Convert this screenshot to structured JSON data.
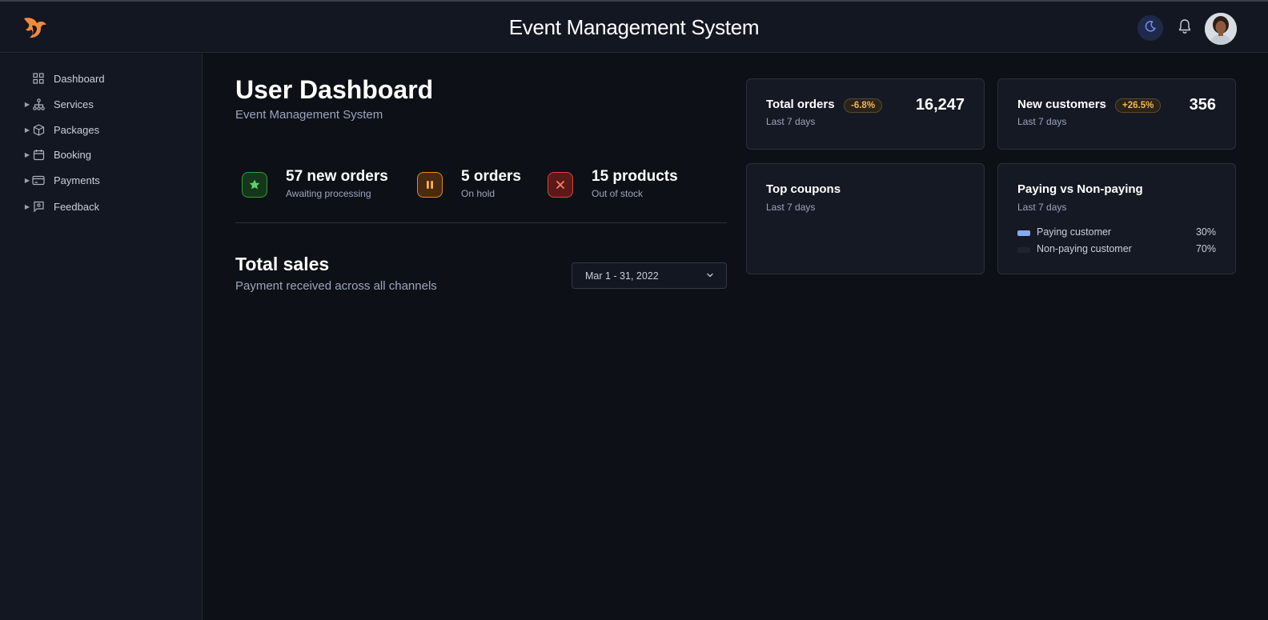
{
  "header": {
    "title": "Event Management System",
    "logo_icon": "flame-logo",
    "theme_icon": "moon-icon",
    "notification_icon": "bell-icon",
    "avatar_icon": "user-avatar"
  },
  "sidebar": {
    "items": [
      {
        "label": "Dashboard",
        "icon": "grid-icon",
        "expandable": false
      },
      {
        "label": "Services",
        "icon": "sitemap-icon",
        "expandable": true
      },
      {
        "label": "Packages",
        "icon": "box-icon",
        "expandable": true
      },
      {
        "label": "Booking",
        "icon": "calendar-icon",
        "expandable": true
      },
      {
        "label": "Payments",
        "icon": "credit-card-icon",
        "expandable": true
      },
      {
        "label": "Feedback",
        "icon": "feedback-icon",
        "expandable": true
      }
    ]
  },
  "main": {
    "title": "User Dashboard",
    "subtitle": "Event Management System",
    "stats": [
      {
        "value": "57 new orders",
        "label": "Awaiting processing",
        "icon": "star-icon",
        "color": "#2f9e3a"
      },
      {
        "value": "5 orders",
        "label": "On hold",
        "icon": "pause-icon",
        "color": "#e08a1e"
      },
      {
        "value": "15 products",
        "label": "Out of stock",
        "icon": "x-icon",
        "color": "#d6453a"
      }
    ],
    "sales": {
      "title": "Total sales",
      "subtitle": "Payment received across all channels",
      "date_range": "Mar 1 - 31, 2022"
    }
  },
  "cards": {
    "total_orders": {
      "title": "Total orders",
      "badge": "-6.8%",
      "value": "16,247",
      "period": "Last 7 days"
    },
    "new_customers": {
      "title": "New customers",
      "badge": "+26.5%",
      "value": "356",
      "period": "Last 7 days"
    },
    "top_coupons": {
      "title": "Top coupons",
      "period": "Last 7 days"
    },
    "paying": {
      "title": "Paying vs Non-paying",
      "period": "Last 7 days",
      "legend": [
        {
          "label": "Paying customer",
          "pct": "30%",
          "color": "#85a9f5"
        },
        {
          "label": "Non-paying customer",
          "pct": "70%",
          "color": "#1e2331"
        }
      ]
    }
  }
}
